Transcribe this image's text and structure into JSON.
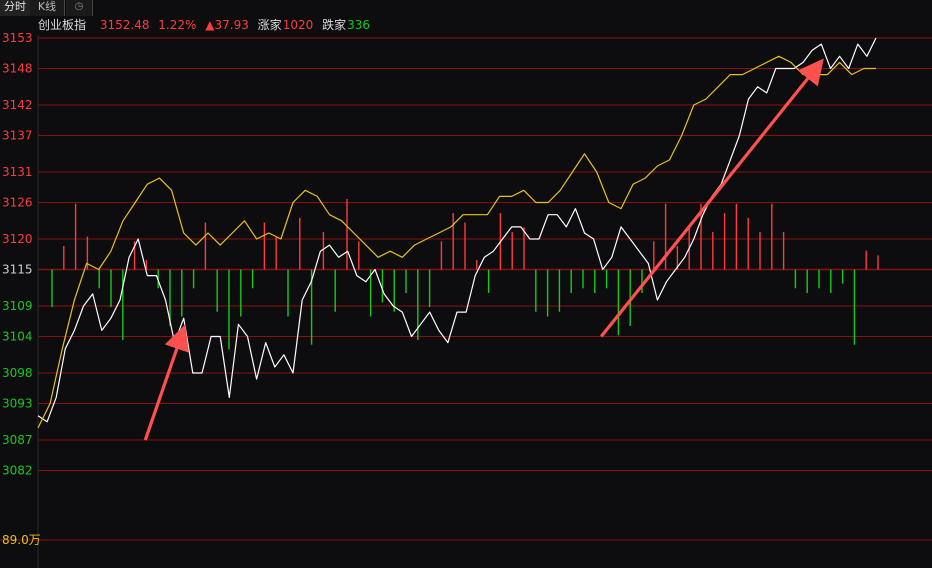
{
  "tabs": [
    {
      "label": "分时",
      "active": true
    },
    {
      "label": "K线",
      "active": false
    }
  ],
  "header": {
    "index_name": "创业板指",
    "price": "3152.48",
    "change_pct": "1.22%",
    "change_pts": "▲37.93",
    "up_label": "涨家",
    "up_count": "1020",
    "down_label": "跌家",
    "down_count": "336"
  },
  "volume_label": "89.0万",
  "colors": {
    "up": "#ff3b3b",
    "down": "#19c919",
    "price_line": "#ffffff",
    "avg_line": "#e8c21a",
    "grid": "#8a0f0f",
    "arrow": "#ff5050",
    "background": "#0d0d0f"
  },
  "chart_data": {
    "type": "line",
    "title": "",
    "xlabel": "",
    "ylabel": "",
    "ylim": [
      3076.5,
      3153.5
    ],
    "y_ticks": [
      "3153",
      "3148",
      "3142",
      "3137",
      "3131",
      "3126",
      "3120",
      "3115",
      "3109",
      "3104",
      "3098",
      "3093",
      "3087",
      "3082"
    ],
    "baseline": 3115,
    "series": [
      {
        "style": "white",
        "values": [
          3091,
          3090,
          3094,
          3102,
          3105,
          3109,
          3111,
          3105,
          3107,
          3110,
          3117,
          3120,
          3114,
          3114,
          3110,
          3103,
          3107,
          3098,
          3098,
          3104,
          3104,
          3094,
          3106,
          3104,
          3097,
          3103,
          3099,
          3101,
          3098,
          3110,
          3113,
          3118,
          3119,
          3117,
          3118,
          3114,
          3113,
          3115,
          3111,
          3109,
          3108,
          3104,
          3106,
          3108,
          3105,
          3103,
          3108,
          3108,
          3114,
          3117,
          3118,
          3120,
          3122,
          3122,
          3120,
          3120,
          3124,
          3124,
          3122,
          3125,
          3121,
          3120,
          3115,
          3117,
          3122,
          3120,
          3118,
          3116,
          3110,
          3113,
          3115,
          3117,
          3120,
          3124,
          3127,
          3129,
          3133,
          3137,
          3143,
          3145,
          3144,
          3148,
          3148,
          3148,
          3149,
          3151,
          3152,
          3148,
          3150,
          3148,
          3152,
          3150,
          3153
        ]
      },
      {
        "style": "yellow",
        "values": [
          3089,
          3093,
          3102,
          3110,
          3116,
          3115,
          3118,
          3123,
          3126,
          3129,
          3130,
          3128,
          3121,
          3119,
          3121,
          3119,
          3121,
          3123,
          3120,
          3121,
          3120,
          3126,
          3128,
          3127,
          3124,
          3123,
          3121,
          3119,
          3117,
          3118,
          3117,
          3119,
          3120,
          3121,
          3122,
          3124,
          3124,
          3124,
          3127,
          3127,
          3128,
          3126,
          3126,
          3128,
          3131,
          3134,
          3131,
          3126,
          3125,
          3129,
          3130,
          3132,
          3133,
          3137,
          3142,
          3143,
          3145,
          3147,
          3147,
          3148,
          3149,
          3150,
          3149,
          3147,
          3147,
          3147,
          3149,
          3147,
          3148,
          3148
        ]
      }
    ]
  },
  "volume_data": {
    "values": [
      -8,
      5,
      14,
      7,
      -4,
      -8,
      -15,
      6,
      2,
      -4,
      -12,
      -10,
      -4,
      10,
      -9,
      -17,
      -10,
      -4,
      10,
      7,
      -10,
      11,
      -16,
      8,
      -9,
      15,
      6,
      -10,
      -7,
      -9,
      -5,
      -15,
      -8,
      6,
      12,
      10,
      2,
      -5,
      12,
      8,
      9,
      -9,
      -10,
      -9,
      -5,
      -4,
      -5,
      -4,
      -14,
      -12,
      -5,
      6,
      14,
      5,
      9,
      14,
      8,
      12,
      14,
      11,
      8,
      14,
      8,
      -4,
      -5,
      -4,
      -5,
      -3,
      -16,
      4,
      3
    ]
  },
  "annotations": [
    {
      "label": "arrow-1",
      "from": [
        12,
        3087
      ],
      "to": [
        16,
        3104
      ]
    },
    {
      "label": "arrow-2",
      "from": [
        63,
        3104
      ],
      "to": [
        87,
        3148
      ]
    }
  ]
}
